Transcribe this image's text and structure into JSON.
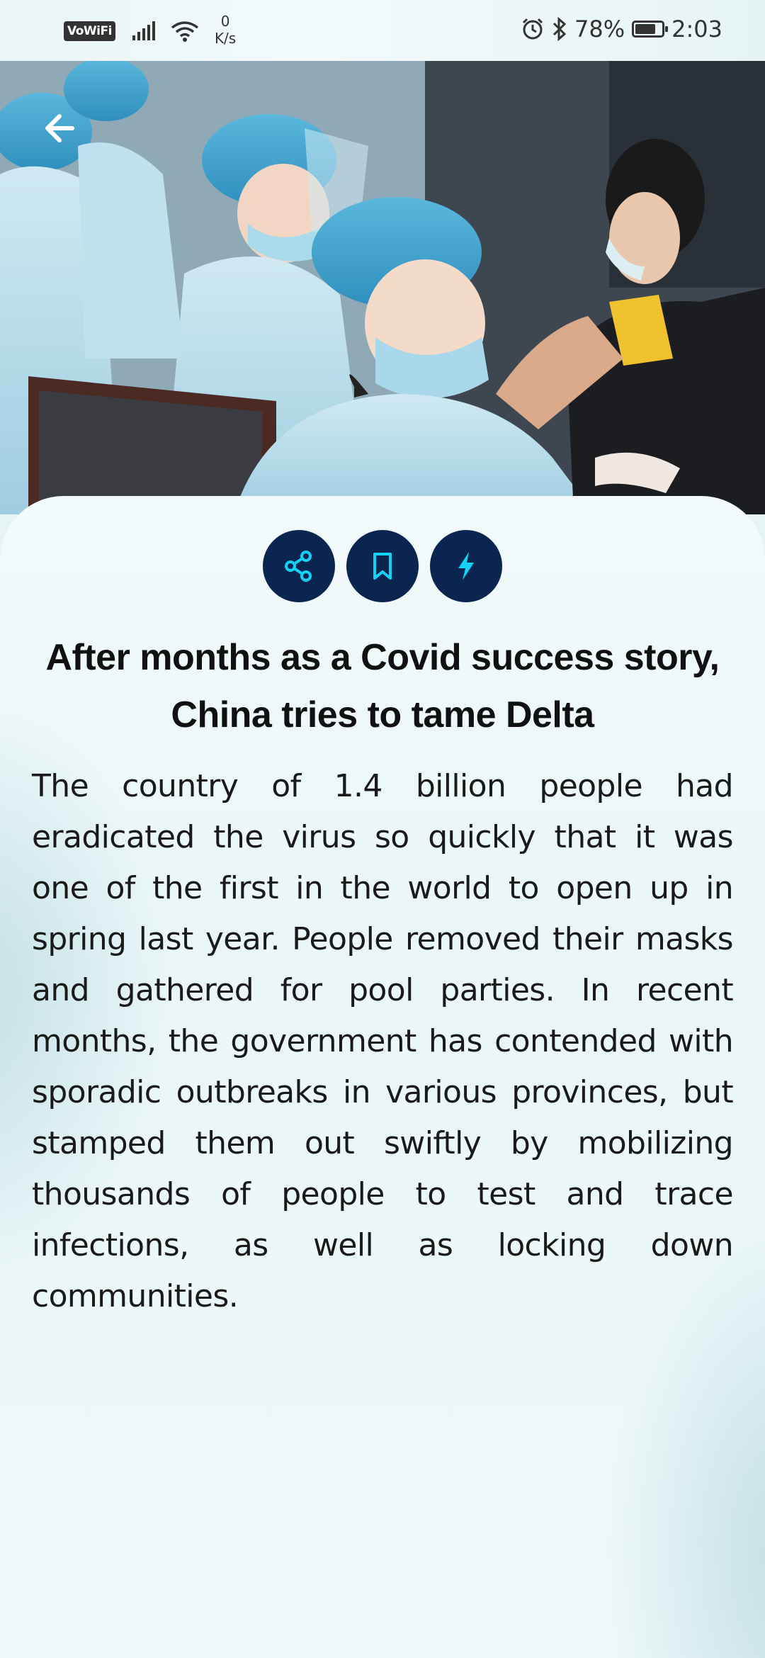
{
  "status_bar": {
    "vowifi": "VoWiFi",
    "speed_value": "0",
    "speed_unit": "K/s",
    "battery": "78%",
    "time": "2:03"
  },
  "hero": {
    "image": "photo-health-workers-in-blue-caps-masks-and-gowns-vaccinating-people"
  },
  "article": {
    "title": "After months as a Covid success story, China tries to tame Delta",
    "body": "The country of 1.4 billion people had eradicated the virus so quickly that it was one of the first in the world to open up in spring last year. People removed their masks and gathered for pool parties. In recent months, the government has contended with sporadic outbreaks in various provinces, but stamped them out swiftly by mobilizing thousands of people to test and trace infections, as well as locking down communities."
  },
  "actions": [
    {
      "name": "share",
      "icon": "share-icon"
    },
    {
      "name": "bookmark",
      "icon": "bookmark-icon"
    },
    {
      "name": "flash",
      "icon": "lightning-icon"
    }
  ],
  "colors": {
    "action_bg": "#0b2551",
    "action_icon": "#12d3f5"
  }
}
